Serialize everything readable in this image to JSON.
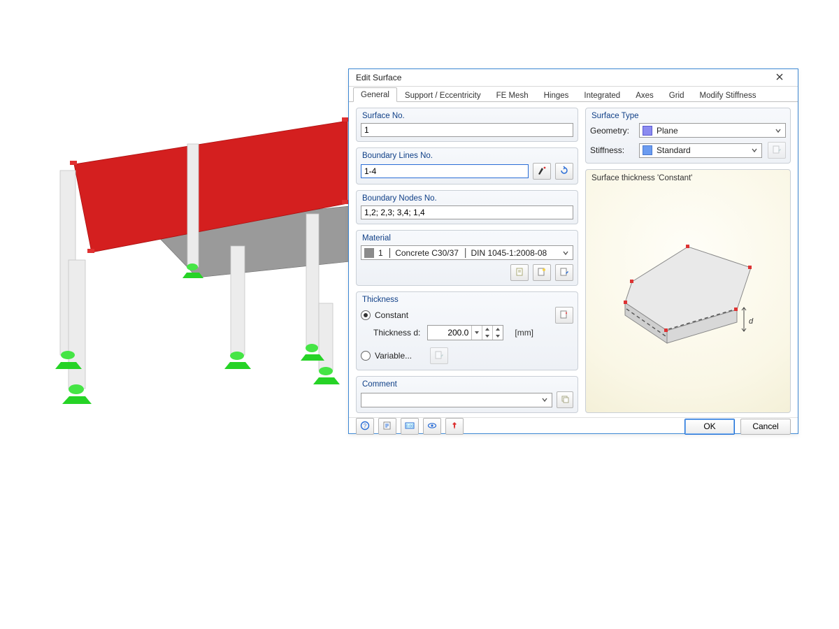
{
  "dialog": {
    "title": "Edit Surface",
    "tabs": [
      "General",
      "Support / Eccentricity",
      "FE Mesh",
      "Hinges",
      "Integrated",
      "Axes",
      "Grid",
      "Modify Stiffness"
    ],
    "active_tab": 0,
    "groups": {
      "surface_no": {
        "title": "Surface No.",
        "value": "1"
      },
      "boundary_lines": {
        "title": "Boundary Lines No.",
        "value": "1-4"
      },
      "boundary_nodes": {
        "title": "Boundary Nodes No.",
        "value": "1,2; 2,3; 3,4; 1,4"
      },
      "material": {
        "title": "Material",
        "value_num": "1",
        "value_name": "Concrete C30/37",
        "value_code": "DIN 1045-1:2008-08"
      },
      "thickness": {
        "title": "Thickness",
        "constant_label": "Constant",
        "variable_label": "Variable...",
        "d_label": "Thickness d:",
        "d_value": "200.0",
        "d_unit": "[mm]"
      },
      "comment": {
        "title": "Comment",
        "value": ""
      },
      "surface_type": {
        "title": "Surface Type",
        "geometry_label": "Geometry:",
        "geometry_value": "Plane",
        "stiffness_label": "Stiffness:",
        "stiffness_value": "Standard"
      },
      "preview_label": "Surface thickness 'Constant'"
    },
    "buttons": {
      "ok": "OK",
      "cancel": "Cancel"
    }
  }
}
